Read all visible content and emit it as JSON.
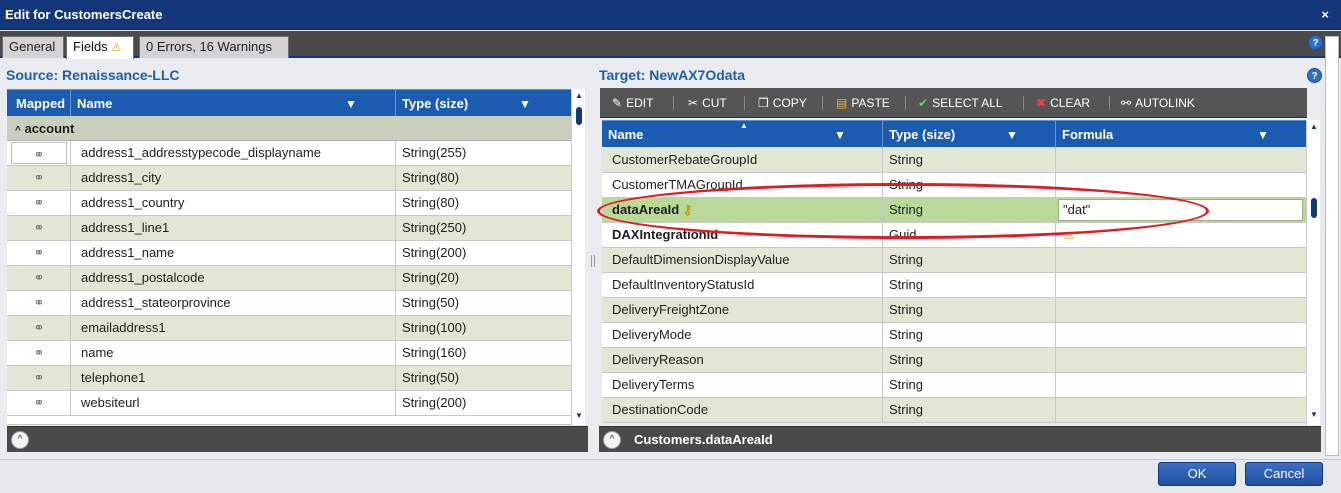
{
  "window": {
    "title": "Edit for CustomersCreate",
    "close_glyph": "×"
  },
  "tabs": [
    {
      "label": "General"
    },
    {
      "label": "Fields"
    },
    {
      "label": "0 Errors, 16 Warnings"
    }
  ],
  "source": {
    "title": "Source: Renaissance-LLC",
    "headers": {
      "mapped": "Mapped",
      "name": "Name",
      "type": "Type (size)"
    },
    "group": "account",
    "rows": [
      {
        "name": "address1_addresstypecode_displayname",
        "type": "String(255)"
      },
      {
        "name": "address1_city",
        "type": "String(80)"
      },
      {
        "name": "address1_country",
        "type": "String(80)"
      },
      {
        "name": "address1_line1",
        "type": "String(250)"
      },
      {
        "name": "address1_name",
        "type": "String(200)"
      },
      {
        "name": "address1_postalcode",
        "type": "String(20)"
      },
      {
        "name": "address1_stateorprovince",
        "type": "String(50)"
      },
      {
        "name": "emailaddress1",
        "type": "String(100)"
      },
      {
        "name": "name",
        "type": "String(160)"
      },
      {
        "name": "telephone1",
        "type": "String(50)"
      },
      {
        "name": "websiteurl",
        "type": "String(200)"
      }
    ]
  },
  "target": {
    "title": "Target: NewAX7Odata",
    "toolbar": {
      "edit": "EDIT",
      "cut": "CUT",
      "copy": "COPY",
      "paste": "PASTE",
      "select_all": "SELECT ALL",
      "clear": "CLEAR",
      "autolink": "AUTOLINK"
    },
    "headers": {
      "name": "Name",
      "type": "Type (size)",
      "formula": "Formula"
    },
    "rows": [
      {
        "name": "CustomerRebateGroupId",
        "type": "String",
        "formula": ""
      },
      {
        "name": "CustomerTMAGroupId",
        "type": "String",
        "formula": ""
      },
      {
        "name": "dataAreaId",
        "type": "String",
        "formula": "\"dat\""
      },
      {
        "name": "DAXIntegrationId",
        "type": "Guid",
        "formula": ""
      },
      {
        "name": "DefaultDimensionDisplayValue",
        "type": "String",
        "formula": ""
      },
      {
        "name": "DefaultInventoryStatusId",
        "type": "String",
        "formula": ""
      },
      {
        "name": "DeliveryFreightZone",
        "type": "String",
        "formula": ""
      },
      {
        "name": "DeliveryMode",
        "type": "String",
        "formula": ""
      },
      {
        "name": "DeliveryReason",
        "type": "String",
        "formula": ""
      },
      {
        "name": "DeliveryTerms",
        "type": "String",
        "formula": ""
      },
      {
        "name": "DestinationCode",
        "type": "String",
        "formula": ""
      }
    ],
    "footer": "Customers.dataAreaId"
  },
  "buttons": {
    "ok": "OK",
    "cancel": "Cancel"
  },
  "colors": {
    "accent": "#1b5bb0",
    "title": "#14367a",
    "highlight": "#e01b24"
  }
}
